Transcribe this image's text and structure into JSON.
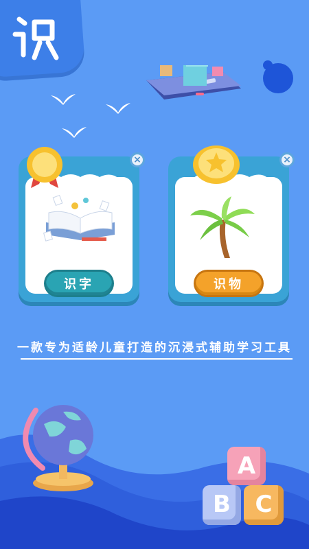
{
  "app": {
    "logo_icon": "shi-character-logo-icon"
  },
  "cards": [
    {
      "id": "recognize-characters",
      "label": "识字",
      "icon": "open-book-icon",
      "badge_icon": "gold-medal-icon",
      "close_icon": "close-icon",
      "close_glyph": "×",
      "button_color": "#2aa4b3"
    },
    {
      "id": "recognize-objects",
      "label": "识物",
      "icon": "palm-tree-icon",
      "badge_icon": "star-coin-icon",
      "close_icon": "close-icon",
      "close_glyph": "×",
      "button_color": "#f4a22a"
    }
  ],
  "tagline": "一款专为适龄儿童打造的沉浸式辅助学习工具",
  "decor": {
    "blocks": [
      "A",
      "B",
      "C"
    ],
    "colors": {
      "background": "#5b9bf5",
      "card_frame": "#3aa3d6",
      "wave_dark": "#1f45c9",
      "wave_mid": "#2f5fdc"
    }
  }
}
